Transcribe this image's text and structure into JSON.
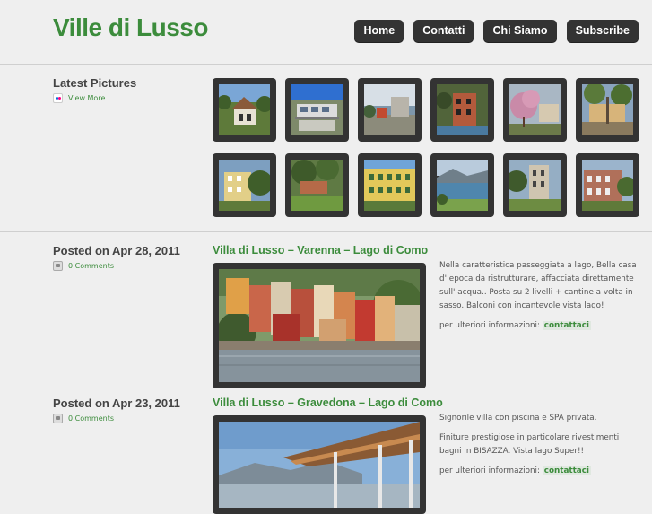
{
  "site": {
    "title": "Ville di Lusso"
  },
  "nav": [
    "Home",
    "Contatti",
    "Chi Siamo",
    "Subscribe"
  ],
  "latest": {
    "heading": "Latest Pictures",
    "view_more": "View More"
  },
  "thumbnails_count": 12,
  "posts": [
    {
      "date": "Posted on Apr 28, 2011",
      "comments": "0 Comments",
      "title": "Villa di Lusso – Varenna – Lago di Como",
      "paragraphs": [
        "Nella caratteristica passeggiata a lago, Bella casa d' epoca da ristrutturare, affacciata direttamente sull' acqua.. Posta su 2 livelli + cantine a volta in sasso. Balconi con incantevole vista lago!"
      ],
      "info_label": "per ulteriori informazioni:",
      "info_link": "contattaci"
    },
    {
      "date": "Posted on Apr 23, 2011",
      "comments": "0 Comments",
      "title": "Villa di Lusso – Gravedona – Lago di Como",
      "paragraphs": [
        "Signorile villa con piscina e SPA privata.",
        "Finiture prestigiose in particolare rivestimenti bagni in BISAZZA. Vista lago Super!!"
      ],
      "info_label": "per ulteriori informazioni:",
      "info_link": "contattaci"
    }
  ],
  "colors": {
    "accent": "#3c8c3c",
    "button_bg": "#333333",
    "page_bg": "#efefef"
  }
}
